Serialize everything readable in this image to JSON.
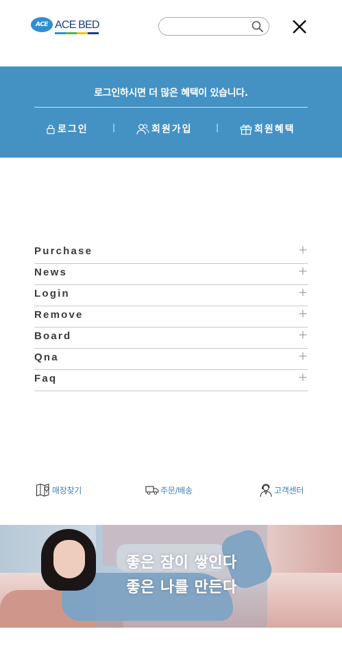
{
  "header": {
    "logo_badge": "ACE",
    "logo_text": "ACE BED",
    "logo_bar_colors": [
      "#2f8fce",
      "#4cb848",
      "#f2c318",
      "#1b3e7a"
    ],
    "search": {
      "value": "",
      "placeholder": "",
      "icon": "search-icon"
    },
    "close_icon": "close-icon"
  },
  "login_band": {
    "background": "#4491c4",
    "message": "로그인하시면 더 많은 혜택이 있습니다.",
    "links": [
      {
        "label": "로그인",
        "icon": "lock-icon"
      },
      {
        "label": "회원가입",
        "icon": "users-icon"
      },
      {
        "label": "회원혜택",
        "icon": "gift-icon"
      }
    ],
    "separator": "|"
  },
  "menu": {
    "items": [
      {
        "label": "Purchase",
        "toggle": "+"
      },
      {
        "label": "News",
        "toggle": "+"
      },
      {
        "label": "Login",
        "toggle": "+"
      },
      {
        "label": "Remove",
        "toggle": "+"
      },
      {
        "label": "Board",
        "toggle": "+"
      },
      {
        "label": "Qna",
        "toggle": "+"
      },
      {
        "label": "Faq",
        "toggle": "+"
      }
    ]
  },
  "quick_links": [
    {
      "label": "매장찾기",
      "icon": "map-icon"
    },
    {
      "label": "주문/배송",
      "icon": "truck-icon"
    },
    {
      "label": "고객센터",
      "icon": "agent-icon"
    }
  ],
  "banner": {
    "line1": "좋은 잠이 쌓인다",
    "line2": "좋은 나를 만든다"
  }
}
